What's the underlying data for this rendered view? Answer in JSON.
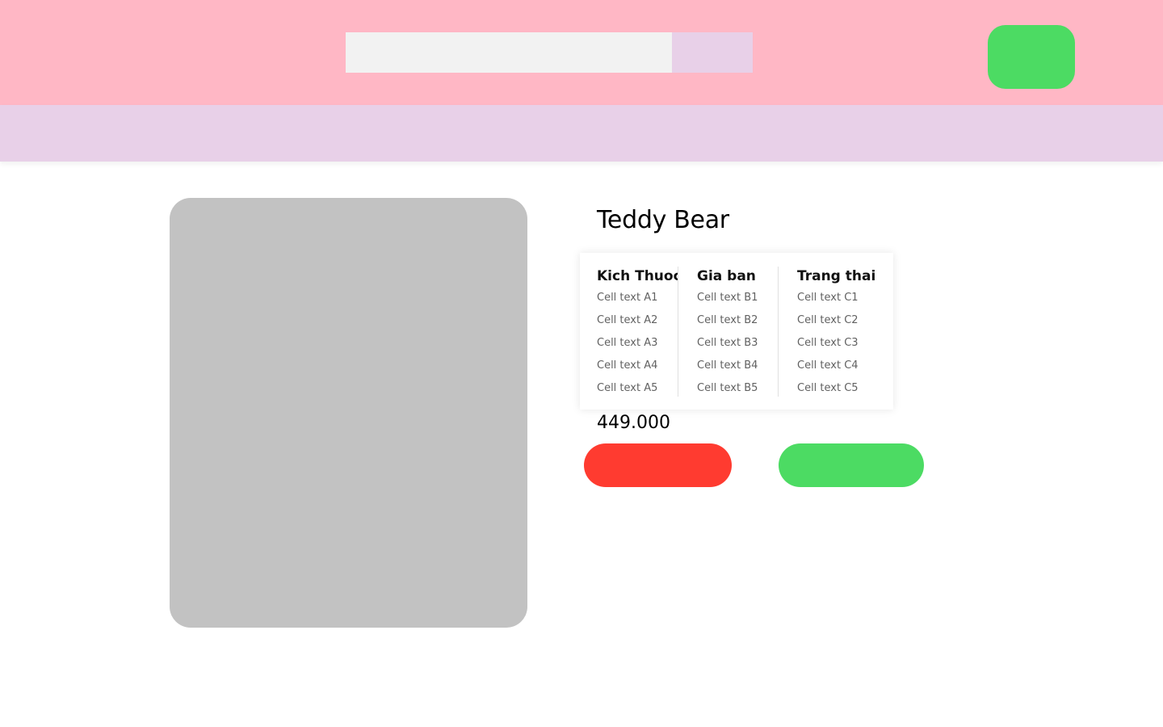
{
  "colors": {
    "header_bg": "#ffb7c5",
    "navbar_bg": "#e8d0e8",
    "search_input_bg": "#f2f2f2",
    "search_button_bg": "#e8d0e8",
    "account_button_bg": "#4cdb63",
    "product_image_bg": "#c2c2c2",
    "buy_button_bg": "#ff3b30",
    "cart_button_bg": "#4cdb63"
  },
  "header": {
    "search": {
      "value": "",
      "placeholder": ""
    },
    "search_button_label": "",
    "account_button_label": ""
  },
  "product": {
    "title": "Teddy Bear",
    "price": "449.000",
    "buy_label": "",
    "cart_label": ""
  },
  "table": {
    "headers": [
      "Kich Thuoc",
      "Gia ban",
      "Trang thai"
    ],
    "columns": [
      [
        "Cell text A1",
        "Cell text A2",
        "Cell text A3",
        "Cell text A4",
        "Cell text A5"
      ],
      [
        "Cell text B1",
        "Cell text B2",
        "Cell text B3",
        "Cell text B4",
        "Cell text B5"
      ],
      [
        "Cell text C1",
        "Cell text C2",
        "Cell text C3",
        "Cell text C4",
        "Cell text C5"
      ]
    ]
  }
}
